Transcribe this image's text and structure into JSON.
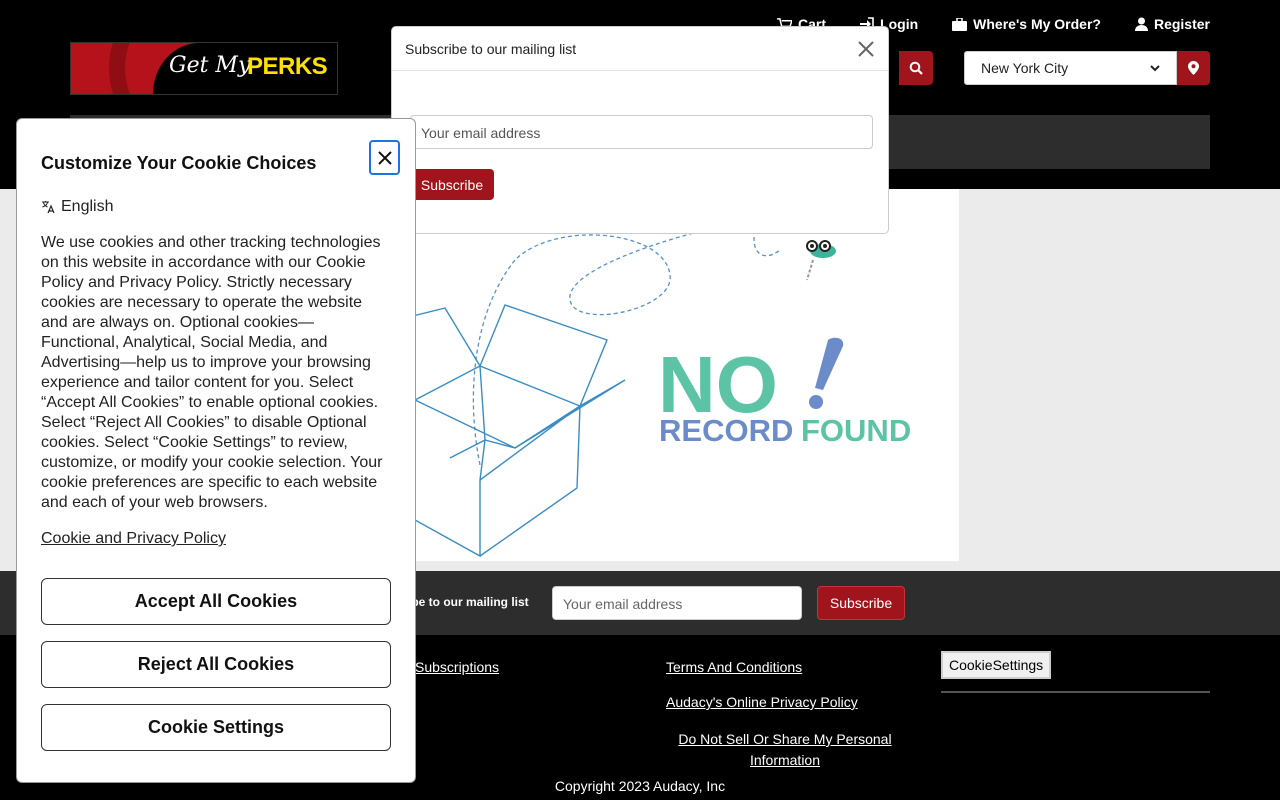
{
  "topnav": {
    "cart": "Cart",
    "login": "Login",
    "orders": "Where's My Order?",
    "register": "Register"
  },
  "logo": {
    "text_script": "Get My",
    "text_bold": "PERKS"
  },
  "location": {
    "selected": "New York City"
  },
  "no_record": {
    "line1": "NO",
    "line2_word1": "RECORD",
    "line2_word2": "FOUND"
  },
  "subscribe_bar": {
    "label": "ibe to our mailing list",
    "placeholder": "Your email address",
    "button": "Subscribe"
  },
  "footer": {
    "subscriptions": "Subscriptions",
    "terms": "Terms And Conditions",
    "privacy": "Audacy's Online Privacy Policy",
    "do_not_sell": "Do Not Sell Or Share My Personal Information",
    "cookie_settings": "CookieSettings",
    "copyright": "Copyright 2023 Audacy, Inc"
  },
  "mailing_modal": {
    "title": "Subscribe to our mailing list",
    "placeholder": "Your email address",
    "button": "Subscribe"
  },
  "cookie_panel": {
    "title": "Customize Your Cookie Choices",
    "language": "English",
    "description": "We use cookies and other tracking technologies on this website in accordance with our Cookie Policy and Privacy Policy. Strictly necessary cookies are necessary to operate the website and are always on. Optional cookies—Functional, Analytical, Social Media, and Advertising—help us to improve your browsing experience and tailor content for you. Select “Accept All Cookies” to enable optional cookies. Select “Reject All Cookies” to disable Optional cookies. Select “Cookie Settings” to review, customize, or modify your cookie selection. Your cookie preferences are specific to each website and each of your web browsers.",
    "policy_link": "Cookie and Privacy Policy",
    "accept": "Accept All Cookies",
    "reject": "Reject All Cookies",
    "settings": "Cookie Settings"
  },
  "colors": {
    "brand_red": "#a0151b",
    "nrf_green": "#5cc4a5",
    "nrf_blue": "#6b8cc9"
  }
}
